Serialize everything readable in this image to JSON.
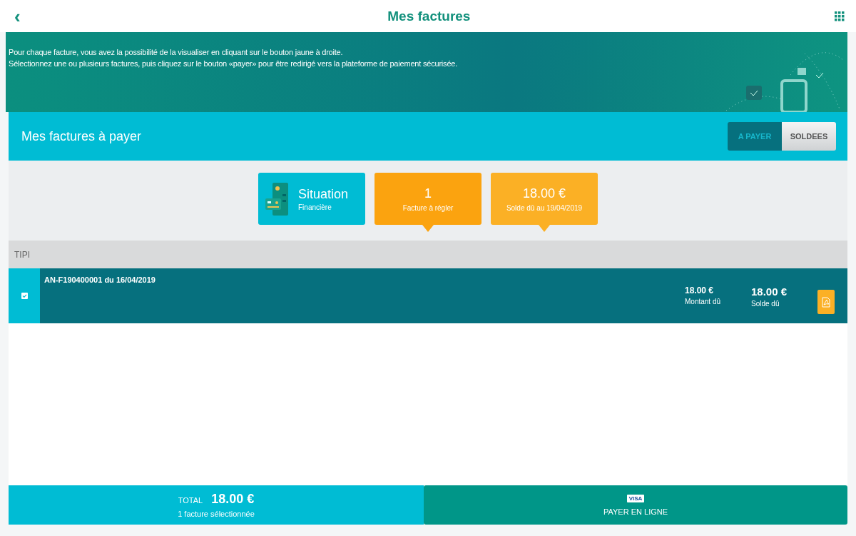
{
  "header": {
    "back": "‹",
    "title": "Mes factures"
  },
  "banner": {
    "lines": [
      "Pour chaque facture, vous avez la possibilité de la visualiser en cliquant sur le bouton jaune à droite.",
      "Sélectionnez une ou plusieurs factures, puis cliquez sur le bouton «payer» pour être redirigé vers la plateforme de paiement sécurisée."
    ]
  },
  "section": {
    "title": "Mes factures à payer",
    "tabs": [
      {
        "label": "A PAYER",
        "selected": true
      },
      {
        "label": "SOLDEES",
        "selected": false
      }
    ]
  },
  "cards": [
    {
      "kind": "situation",
      "value": "Situation",
      "label": "Financière"
    },
    {
      "kind": "stat",
      "value": "1",
      "label": "Facture à régler"
    },
    {
      "kind": "stat",
      "value": "18.00 €",
      "label": "Solde dû au 19/04/2019"
    }
  ],
  "group": {
    "label": "TIPI"
  },
  "invoices": [
    {
      "title": "AN-F190400001 du 16/04/2019",
      "checked": true,
      "amount": "18.00 €",
      "amount_label": "Montant dû",
      "balance": "18.00 €",
      "balance_label": "Solde dû"
    }
  ],
  "footer": {
    "total_label": "TOTAL",
    "total": "18.00 €",
    "selection": "1 facture sélectionnée",
    "card_badge": "VISA",
    "pay": "PAYER EN LIGNE"
  }
}
